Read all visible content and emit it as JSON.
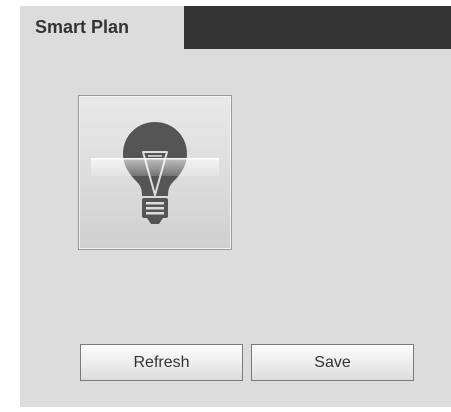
{
  "tabs": [
    {
      "label": "Smart Plan",
      "active": true
    }
  ],
  "plan_tile": {
    "icon": "lightbulb-icon"
  },
  "buttons": {
    "refresh_label": "Refresh",
    "save_label": "Save"
  },
  "colors": {
    "tabbar_bg": "#333333",
    "panel_bg": "#dcdcdc",
    "bulb": "#555555"
  }
}
